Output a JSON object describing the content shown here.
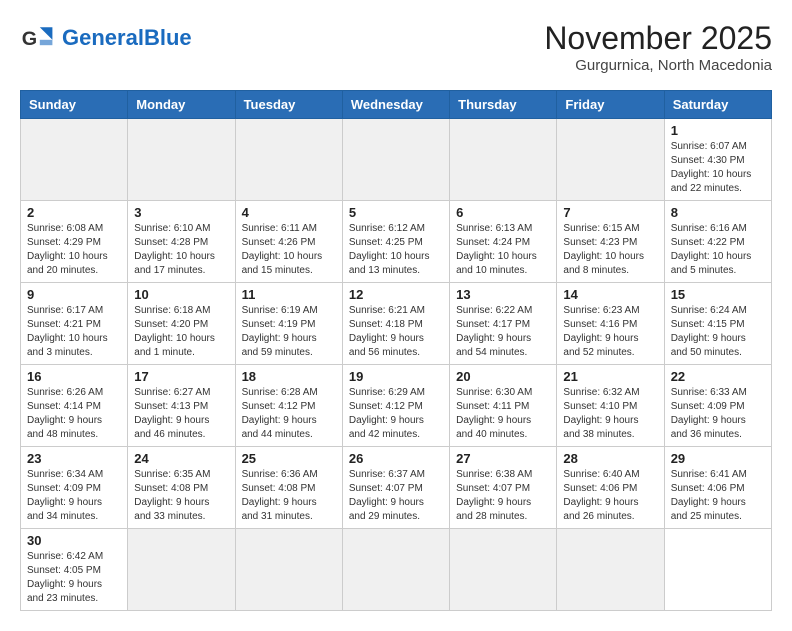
{
  "header": {
    "logo_general": "General",
    "logo_blue": "Blue",
    "month_title": "November 2025",
    "location": "Gurgurnica, North Macedonia"
  },
  "weekdays": [
    "Sunday",
    "Monday",
    "Tuesday",
    "Wednesday",
    "Thursday",
    "Friday",
    "Saturday"
  ],
  "days": [
    {
      "date": "",
      "info": ""
    },
    {
      "date": "",
      "info": ""
    },
    {
      "date": "",
      "info": ""
    },
    {
      "date": "",
      "info": ""
    },
    {
      "date": "",
      "info": ""
    },
    {
      "date": "",
      "info": ""
    },
    {
      "date": "1",
      "info": "Sunrise: 6:07 AM\nSunset: 4:30 PM\nDaylight: 10 hours\nand 22 minutes."
    },
    {
      "date": "2",
      "info": "Sunrise: 6:08 AM\nSunset: 4:29 PM\nDaylight: 10 hours\nand 20 minutes."
    },
    {
      "date": "3",
      "info": "Sunrise: 6:10 AM\nSunset: 4:28 PM\nDaylight: 10 hours\nand 17 minutes."
    },
    {
      "date": "4",
      "info": "Sunrise: 6:11 AM\nSunset: 4:26 PM\nDaylight: 10 hours\nand 15 minutes."
    },
    {
      "date": "5",
      "info": "Sunrise: 6:12 AM\nSunset: 4:25 PM\nDaylight: 10 hours\nand 13 minutes."
    },
    {
      "date": "6",
      "info": "Sunrise: 6:13 AM\nSunset: 4:24 PM\nDaylight: 10 hours\nand 10 minutes."
    },
    {
      "date": "7",
      "info": "Sunrise: 6:15 AM\nSunset: 4:23 PM\nDaylight: 10 hours\nand 8 minutes."
    },
    {
      "date": "8",
      "info": "Sunrise: 6:16 AM\nSunset: 4:22 PM\nDaylight: 10 hours\nand 5 minutes."
    },
    {
      "date": "9",
      "info": "Sunrise: 6:17 AM\nSunset: 4:21 PM\nDaylight: 10 hours\nand 3 minutes."
    },
    {
      "date": "10",
      "info": "Sunrise: 6:18 AM\nSunset: 4:20 PM\nDaylight: 10 hours\nand 1 minute."
    },
    {
      "date": "11",
      "info": "Sunrise: 6:19 AM\nSunset: 4:19 PM\nDaylight: 9 hours\nand 59 minutes."
    },
    {
      "date": "12",
      "info": "Sunrise: 6:21 AM\nSunset: 4:18 PM\nDaylight: 9 hours\nand 56 minutes."
    },
    {
      "date": "13",
      "info": "Sunrise: 6:22 AM\nSunset: 4:17 PM\nDaylight: 9 hours\nand 54 minutes."
    },
    {
      "date": "14",
      "info": "Sunrise: 6:23 AM\nSunset: 4:16 PM\nDaylight: 9 hours\nand 52 minutes."
    },
    {
      "date": "15",
      "info": "Sunrise: 6:24 AM\nSunset: 4:15 PM\nDaylight: 9 hours\nand 50 minutes."
    },
    {
      "date": "16",
      "info": "Sunrise: 6:26 AM\nSunset: 4:14 PM\nDaylight: 9 hours\nand 48 minutes."
    },
    {
      "date": "17",
      "info": "Sunrise: 6:27 AM\nSunset: 4:13 PM\nDaylight: 9 hours\nand 46 minutes."
    },
    {
      "date": "18",
      "info": "Sunrise: 6:28 AM\nSunset: 4:12 PM\nDaylight: 9 hours\nand 44 minutes."
    },
    {
      "date": "19",
      "info": "Sunrise: 6:29 AM\nSunset: 4:12 PM\nDaylight: 9 hours\nand 42 minutes."
    },
    {
      "date": "20",
      "info": "Sunrise: 6:30 AM\nSunset: 4:11 PM\nDaylight: 9 hours\nand 40 minutes."
    },
    {
      "date": "21",
      "info": "Sunrise: 6:32 AM\nSunset: 4:10 PM\nDaylight: 9 hours\nand 38 minutes."
    },
    {
      "date": "22",
      "info": "Sunrise: 6:33 AM\nSunset: 4:09 PM\nDaylight: 9 hours\nand 36 minutes."
    },
    {
      "date": "23",
      "info": "Sunrise: 6:34 AM\nSunset: 4:09 PM\nDaylight: 9 hours\nand 34 minutes."
    },
    {
      "date": "24",
      "info": "Sunrise: 6:35 AM\nSunset: 4:08 PM\nDaylight: 9 hours\nand 33 minutes."
    },
    {
      "date": "25",
      "info": "Sunrise: 6:36 AM\nSunset: 4:08 PM\nDaylight: 9 hours\nand 31 minutes."
    },
    {
      "date": "26",
      "info": "Sunrise: 6:37 AM\nSunset: 4:07 PM\nDaylight: 9 hours\nand 29 minutes."
    },
    {
      "date": "27",
      "info": "Sunrise: 6:38 AM\nSunset: 4:07 PM\nDaylight: 9 hours\nand 28 minutes."
    },
    {
      "date": "28",
      "info": "Sunrise: 6:40 AM\nSunset: 4:06 PM\nDaylight: 9 hours\nand 26 minutes."
    },
    {
      "date": "29",
      "info": "Sunrise: 6:41 AM\nSunset: 4:06 PM\nDaylight: 9 hours\nand 25 minutes."
    },
    {
      "date": "30",
      "info": "Sunrise: 6:42 AM\nSunset: 4:05 PM\nDaylight: 9 hours\nand 23 minutes."
    },
    {
      "date": "",
      "info": ""
    },
    {
      "date": "",
      "info": ""
    },
    {
      "date": "",
      "info": ""
    },
    {
      "date": "",
      "info": ""
    },
    {
      "date": "",
      "info": ""
    }
  ]
}
